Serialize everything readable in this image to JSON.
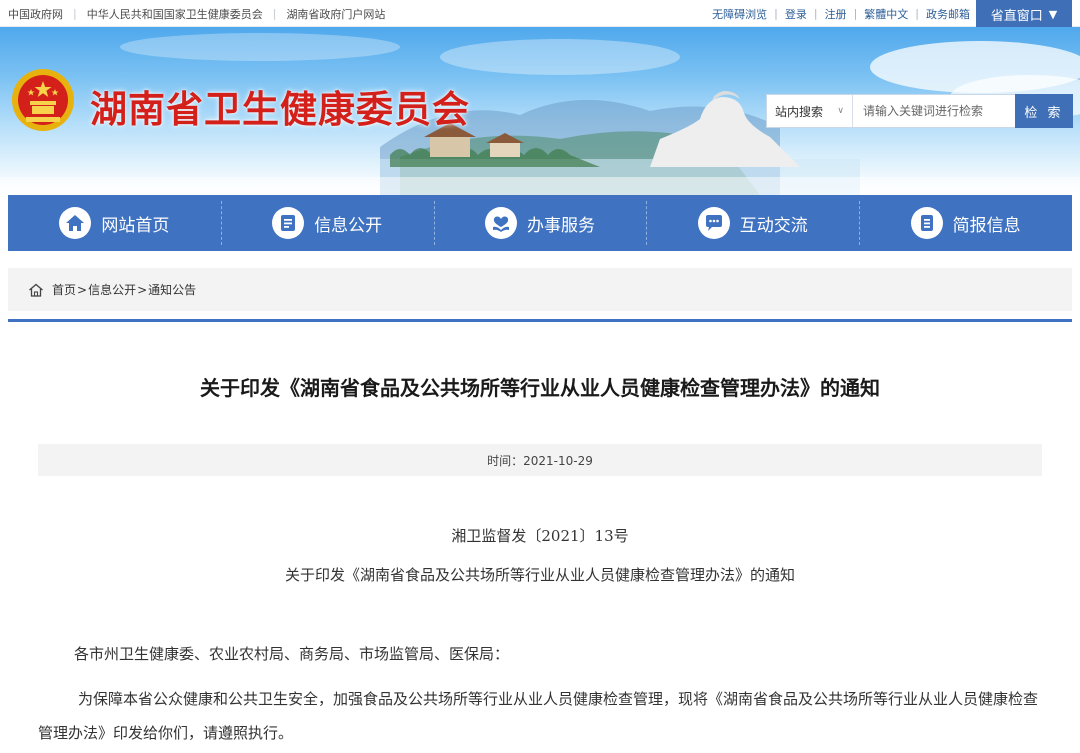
{
  "topbar": {
    "links": [
      "中国政府网",
      "中华人民共和国国家卫生健康委员会",
      "湖南省政府门户网站"
    ],
    "right_links": [
      "无障碍浏览",
      "登录",
      "注册",
      "繁體中文",
      "政务邮箱"
    ],
    "window_button": "省直窗口",
    "window_arrow": "▼"
  },
  "header": {
    "site_name": "湖南省卫生健康委员会"
  },
  "search": {
    "scope": "站内搜索",
    "placeholder": "请输入关键词进行检索",
    "button": "检 索"
  },
  "nav": {
    "items": [
      {
        "label": "网站首页",
        "icon": "home-icon"
      },
      {
        "label": "信息公开",
        "icon": "document-list-icon"
      },
      {
        "label": "办事服务",
        "icon": "heart-hands-icon"
      },
      {
        "label": "互动交流",
        "icon": "chat-bubble-icon"
      },
      {
        "label": "简报信息",
        "icon": "report-icon"
      }
    ],
    "accent_color": "#3f72c0"
  },
  "breadcrumb": {
    "items": [
      "首页",
      "信息公开",
      "通知公告"
    ],
    "separator": ">"
  },
  "article": {
    "title": "关于印发《湖南省食品及公共场所等行业从业人员健康检查管理办法》的通知",
    "time": "时间：2021-10-29",
    "doc_number": "湘卫监督发〔2021〕13号",
    "sub_title": "关于印发《湖南省食品及公共场所等行业从业人员健康检查管理办法》的通知",
    "addressee": "各市州卫生健康委、农业农村局、商务局、市场监管局、医保局：",
    "paragraph": "为保障本省公众健康和公共卫生安全，加强食品及公共场所等行业从业人员健康检查管理，现将《湖南省食品及公共场所等行业从业人员健康检查管理办法》印发给你们，请遵照执行。"
  },
  "colors": {
    "brand_red": "#d4201a",
    "nav_blue": "#3f72c0",
    "button_blue": "#3f6fb6"
  }
}
